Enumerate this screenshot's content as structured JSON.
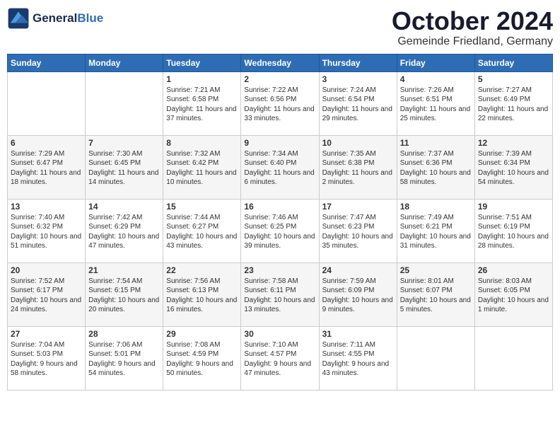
{
  "header": {
    "logo_line1": "General",
    "logo_line2": "Blue",
    "month_title": "October 2024",
    "subtitle": "Gemeinde Friedland, Germany"
  },
  "weekdays": [
    "Sunday",
    "Monday",
    "Tuesday",
    "Wednesday",
    "Thursday",
    "Friday",
    "Saturday"
  ],
  "weeks": [
    [
      {
        "day": "",
        "sunrise": "",
        "sunset": "",
        "daylight": ""
      },
      {
        "day": "",
        "sunrise": "",
        "sunset": "",
        "daylight": ""
      },
      {
        "day": "1",
        "sunrise": "Sunrise: 7:21 AM",
        "sunset": "Sunset: 6:58 PM",
        "daylight": "Daylight: 11 hours and 37 minutes."
      },
      {
        "day": "2",
        "sunrise": "Sunrise: 7:22 AM",
        "sunset": "Sunset: 6:56 PM",
        "daylight": "Daylight: 11 hours and 33 minutes."
      },
      {
        "day": "3",
        "sunrise": "Sunrise: 7:24 AM",
        "sunset": "Sunset: 6:54 PM",
        "daylight": "Daylight: 11 hours and 29 minutes."
      },
      {
        "day": "4",
        "sunrise": "Sunrise: 7:26 AM",
        "sunset": "Sunset: 6:51 PM",
        "daylight": "Daylight: 11 hours and 25 minutes."
      },
      {
        "day": "5",
        "sunrise": "Sunrise: 7:27 AM",
        "sunset": "Sunset: 6:49 PM",
        "daylight": "Daylight: 11 hours and 22 minutes."
      }
    ],
    [
      {
        "day": "6",
        "sunrise": "Sunrise: 7:29 AM",
        "sunset": "Sunset: 6:47 PM",
        "daylight": "Daylight: 11 hours and 18 minutes."
      },
      {
        "day": "7",
        "sunrise": "Sunrise: 7:30 AM",
        "sunset": "Sunset: 6:45 PM",
        "daylight": "Daylight: 11 hours and 14 minutes."
      },
      {
        "day": "8",
        "sunrise": "Sunrise: 7:32 AM",
        "sunset": "Sunset: 6:42 PM",
        "daylight": "Daylight: 11 hours and 10 minutes."
      },
      {
        "day": "9",
        "sunrise": "Sunrise: 7:34 AM",
        "sunset": "Sunset: 6:40 PM",
        "daylight": "Daylight: 11 hours and 6 minutes."
      },
      {
        "day": "10",
        "sunrise": "Sunrise: 7:35 AM",
        "sunset": "Sunset: 6:38 PM",
        "daylight": "Daylight: 11 hours and 2 minutes."
      },
      {
        "day": "11",
        "sunrise": "Sunrise: 7:37 AM",
        "sunset": "Sunset: 6:36 PM",
        "daylight": "Daylight: 10 hours and 58 minutes."
      },
      {
        "day": "12",
        "sunrise": "Sunrise: 7:39 AM",
        "sunset": "Sunset: 6:34 PM",
        "daylight": "Daylight: 10 hours and 54 minutes."
      }
    ],
    [
      {
        "day": "13",
        "sunrise": "Sunrise: 7:40 AM",
        "sunset": "Sunset: 6:32 PM",
        "daylight": "Daylight: 10 hours and 51 minutes."
      },
      {
        "day": "14",
        "sunrise": "Sunrise: 7:42 AM",
        "sunset": "Sunset: 6:29 PM",
        "daylight": "Daylight: 10 hours and 47 minutes."
      },
      {
        "day": "15",
        "sunrise": "Sunrise: 7:44 AM",
        "sunset": "Sunset: 6:27 PM",
        "daylight": "Daylight: 10 hours and 43 minutes."
      },
      {
        "day": "16",
        "sunrise": "Sunrise: 7:46 AM",
        "sunset": "Sunset: 6:25 PM",
        "daylight": "Daylight: 10 hours and 39 minutes."
      },
      {
        "day": "17",
        "sunrise": "Sunrise: 7:47 AM",
        "sunset": "Sunset: 6:23 PM",
        "daylight": "Daylight: 10 hours and 35 minutes."
      },
      {
        "day": "18",
        "sunrise": "Sunrise: 7:49 AM",
        "sunset": "Sunset: 6:21 PM",
        "daylight": "Daylight: 10 hours and 31 minutes."
      },
      {
        "day": "19",
        "sunrise": "Sunrise: 7:51 AM",
        "sunset": "Sunset: 6:19 PM",
        "daylight": "Daylight: 10 hours and 28 minutes."
      }
    ],
    [
      {
        "day": "20",
        "sunrise": "Sunrise: 7:52 AM",
        "sunset": "Sunset: 6:17 PM",
        "daylight": "Daylight: 10 hours and 24 minutes."
      },
      {
        "day": "21",
        "sunrise": "Sunrise: 7:54 AM",
        "sunset": "Sunset: 6:15 PM",
        "daylight": "Daylight: 10 hours and 20 minutes."
      },
      {
        "day": "22",
        "sunrise": "Sunrise: 7:56 AM",
        "sunset": "Sunset: 6:13 PM",
        "daylight": "Daylight: 10 hours and 16 minutes."
      },
      {
        "day": "23",
        "sunrise": "Sunrise: 7:58 AM",
        "sunset": "Sunset: 6:11 PM",
        "daylight": "Daylight: 10 hours and 13 minutes."
      },
      {
        "day": "24",
        "sunrise": "Sunrise: 7:59 AM",
        "sunset": "Sunset: 6:09 PM",
        "daylight": "Daylight: 10 hours and 9 minutes."
      },
      {
        "day": "25",
        "sunrise": "Sunrise: 8:01 AM",
        "sunset": "Sunset: 6:07 PM",
        "daylight": "Daylight: 10 hours and 5 minutes."
      },
      {
        "day": "26",
        "sunrise": "Sunrise: 8:03 AM",
        "sunset": "Sunset: 6:05 PM",
        "daylight": "Daylight: 10 hours and 1 minute."
      }
    ],
    [
      {
        "day": "27",
        "sunrise": "Sunrise: 7:04 AM",
        "sunset": "Sunset: 5:03 PM",
        "daylight": "Daylight: 9 hours and 58 minutes."
      },
      {
        "day": "28",
        "sunrise": "Sunrise: 7:06 AM",
        "sunset": "Sunset: 5:01 PM",
        "daylight": "Daylight: 9 hours and 54 minutes."
      },
      {
        "day": "29",
        "sunrise": "Sunrise: 7:08 AM",
        "sunset": "Sunset: 4:59 PM",
        "daylight": "Daylight: 9 hours and 50 minutes."
      },
      {
        "day": "30",
        "sunrise": "Sunrise: 7:10 AM",
        "sunset": "Sunset: 4:57 PM",
        "daylight": "Daylight: 9 hours and 47 minutes."
      },
      {
        "day": "31",
        "sunrise": "Sunrise: 7:11 AM",
        "sunset": "Sunset: 4:55 PM",
        "daylight": "Daylight: 9 hours and 43 minutes."
      },
      {
        "day": "",
        "sunrise": "",
        "sunset": "",
        "daylight": ""
      },
      {
        "day": "",
        "sunrise": "",
        "sunset": "",
        "daylight": ""
      }
    ]
  ]
}
